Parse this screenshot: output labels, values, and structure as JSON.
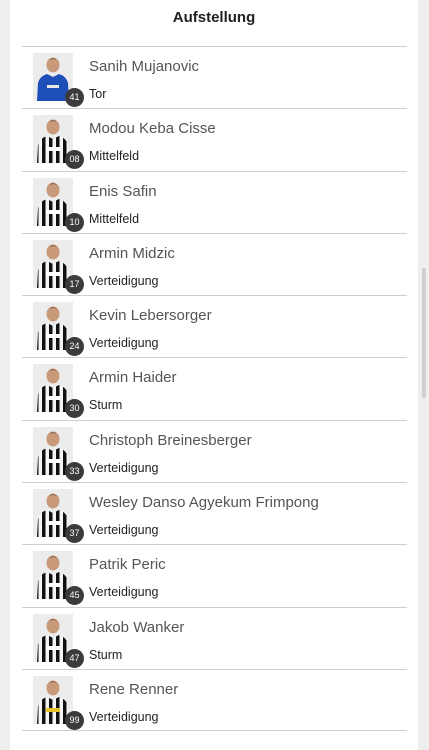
{
  "section_title": "Aufstellung",
  "players": [
    {
      "number": "41",
      "name": "Sanih Mujanovic",
      "position": "Tor",
      "kit": "goalkeeper-blue"
    },
    {
      "number": "08",
      "name": "Modou Keba Cisse",
      "position": "Mittelfeld",
      "kit": "stripes"
    },
    {
      "number": "10",
      "name": "Enis Safin",
      "position": "Mittelfeld",
      "kit": "stripes"
    },
    {
      "number": "17",
      "name": "Armin Midzic",
      "position": "Verteidigung",
      "kit": "stripes"
    },
    {
      "number": "24",
      "name": "Kevin Lebersorger",
      "position": "Verteidigung",
      "kit": "stripes"
    },
    {
      "number": "30",
      "name": "Armin Haider",
      "position": "Sturm",
      "kit": "stripes"
    },
    {
      "number": "33",
      "name": "Christoph Breinesberger",
      "position": "Verteidigung",
      "kit": "stripes"
    },
    {
      "number": "37",
      "name": "Wesley Danso Agyekum Frimpong",
      "position": "Verteidigung",
      "kit": "stripes"
    },
    {
      "number": "45",
      "name": "Patrik Peric",
      "position": "Verteidigung",
      "kit": "stripes"
    },
    {
      "number": "47",
      "name": "Jakob Wanker",
      "position": "Sturm",
      "kit": "stripes"
    },
    {
      "number": "99",
      "name": "Rene Renner",
      "position": "Verteidigung",
      "kit": "stripes-sponsor"
    }
  ],
  "colors": {
    "badge": "#3b3b3b",
    "divider": "#cfcfcf",
    "goalkeeper_kit": "#1d4fb8",
    "striped_kit_dark": "#111111",
    "striped_kit_light": "#f4f4f4"
  }
}
